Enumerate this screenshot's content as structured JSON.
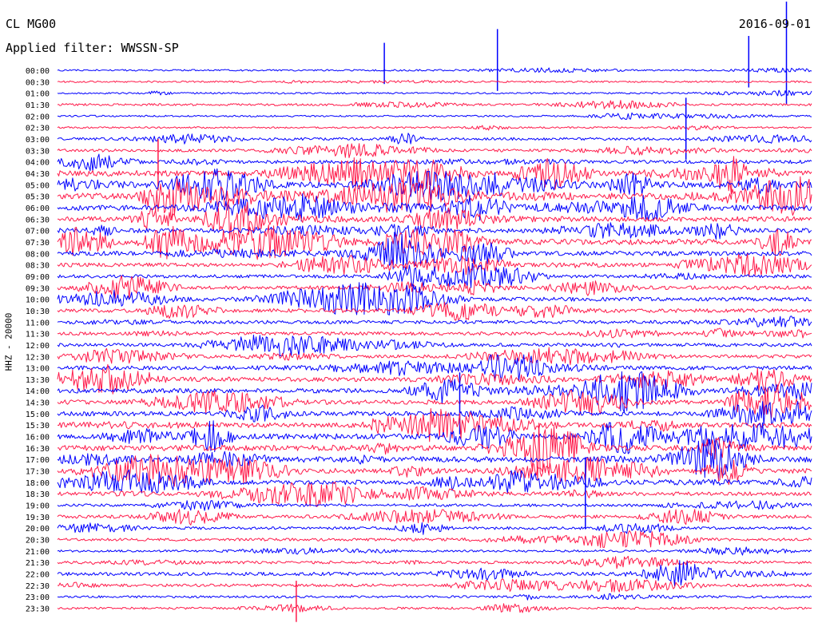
{
  "header": {
    "station": "CL MG00",
    "date": "2016-09-01",
    "filter_label": "Applied filter: WWSSN-SP"
  },
  "chart_data": {
    "type": "line",
    "title": "CL MG00",
    "date": "2016-09-01",
    "filter": "WWSSN-SP",
    "ylabel": "HHZ - 20000",
    "colors": [
      "#0000ff",
      "#ff1a4a"
    ],
    "categories": [
      "00:00",
      "00:30",
      "01:00",
      "01:30",
      "02:00",
      "02:30",
      "03:00",
      "03:30",
      "04:00",
      "04:30",
      "05:00",
      "05:30",
      "06:00",
      "06:30",
      "07:00",
      "07:30",
      "08:00",
      "08:30",
      "09:00",
      "09:30",
      "10:00",
      "10:30",
      "11:00",
      "11:30",
      "12:00",
      "12:30",
      "13:00",
      "13:30",
      "14:00",
      "14:30",
      "15:00",
      "15:30",
      "16:00",
      "16:30",
      "17:00",
      "17:30",
      "18:00",
      "18:30",
      "19:00",
      "19:30",
      "20:00",
      "20:30",
      "21:00",
      "21:30",
      "22:00",
      "22:30",
      "23:00",
      "23:30"
    ],
    "activity": [
      1,
      1,
      1,
      2,
      1,
      1,
      3,
      3,
      4,
      8,
      9,
      9,
      8,
      7,
      6,
      8,
      6,
      5,
      4,
      5,
      5,
      5,
      4,
      4,
      4,
      4,
      5,
      6,
      6,
      6,
      6,
      7,
      8,
      8,
      8,
      7,
      6,
      5,
      3,
      4,
      3,
      3,
      2,
      3,
      4,
      3,
      2,
      2
    ],
    "spikes_minutes": [
      {
        "row": 0,
        "minute": 13,
        "amp": 4
      },
      {
        "row": 0,
        "minute": 29,
        "amp": 10
      },
      {
        "row": 0,
        "minute": 17.5,
        "amp": 6
      },
      {
        "row": 0,
        "minute": 27.5,
        "amp": 5
      },
      {
        "row": 6,
        "minute": 25,
        "amp": 6
      },
      {
        "row": 9,
        "minute": 4,
        "amp": 5
      },
      {
        "row": 30,
        "minute": 16,
        "amp": 6
      },
      {
        "row": 38,
        "minute": 21,
        "amp": 7
      },
      {
        "row": 47,
        "minute": 9.5,
        "amp": 4
      }
    ]
  }
}
